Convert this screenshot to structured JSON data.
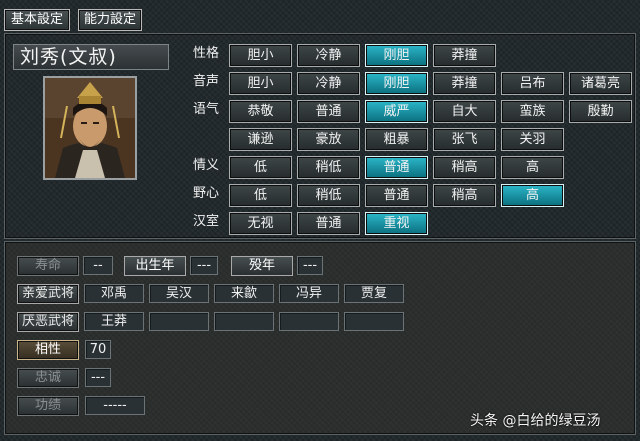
{
  "tabs": [
    {
      "label": "基本設定",
      "selected": true
    },
    {
      "label": "能力設定",
      "selected": false
    }
  ],
  "general": {
    "name": "刘秀(文叔)"
  },
  "attributes": [
    {
      "key": "性格",
      "options": [
        "胆小",
        "冷静",
        "刚胆",
        "莽撞"
      ],
      "selected": 2
    },
    {
      "key": "音声",
      "options": [
        "胆小",
        "冷静",
        "刚胆",
        "莽撞",
        "吕布",
        "诸葛亮"
      ],
      "selected": 2
    },
    {
      "key": "语气",
      "options": [
        "恭敬",
        "普通",
        "威严",
        "自大",
        "蛮族",
        "殷勤",
        "谦逊",
        "豪放",
        "粗暴",
        "张飞",
        "关羽"
      ],
      "selected": 2
    },
    {
      "key": "情义",
      "options": [
        "低",
        "稍低",
        "普通",
        "稍高",
        "高"
      ],
      "selected": 2
    },
    {
      "key": "野心",
      "options": [
        "低",
        "稍低",
        "普通",
        "稍高",
        "高"
      ],
      "selected": 4
    },
    {
      "key": "汉室",
      "options": [
        "无视",
        "普通",
        "重视"
      ],
      "selected": 2
    }
  ],
  "info": {
    "lifespan": {
      "label": "寿命",
      "value": "--"
    },
    "birth_year": {
      "label": "出生年",
      "value": "---"
    },
    "death_year": {
      "label": "殁年",
      "value": "---"
    },
    "close_generals": {
      "label": "亲爱武将",
      "values": [
        "邓禹",
        "吴汉",
        "来歙",
        "冯异",
        "贾复"
      ]
    },
    "hated_generals": {
      "label": "厌恶武将",
      "values": [
        "王莽",
        "",
        "",
        "",
        ""
      ]
    },
    "compatibility": {
      "label": "相性",
      "value": "70"
    },
    "loyalty": {
      "label": "忠诚",
      "value": "---"
    },
    "merit": {
      "label": "功绩",
      "value": "-----"
    }
  },
  "watermark": "头条 @白给的绿豆汤",
  "colors": {
    "selected": "#1a9bb0",
    "background": "#1f2629"
  }
}
